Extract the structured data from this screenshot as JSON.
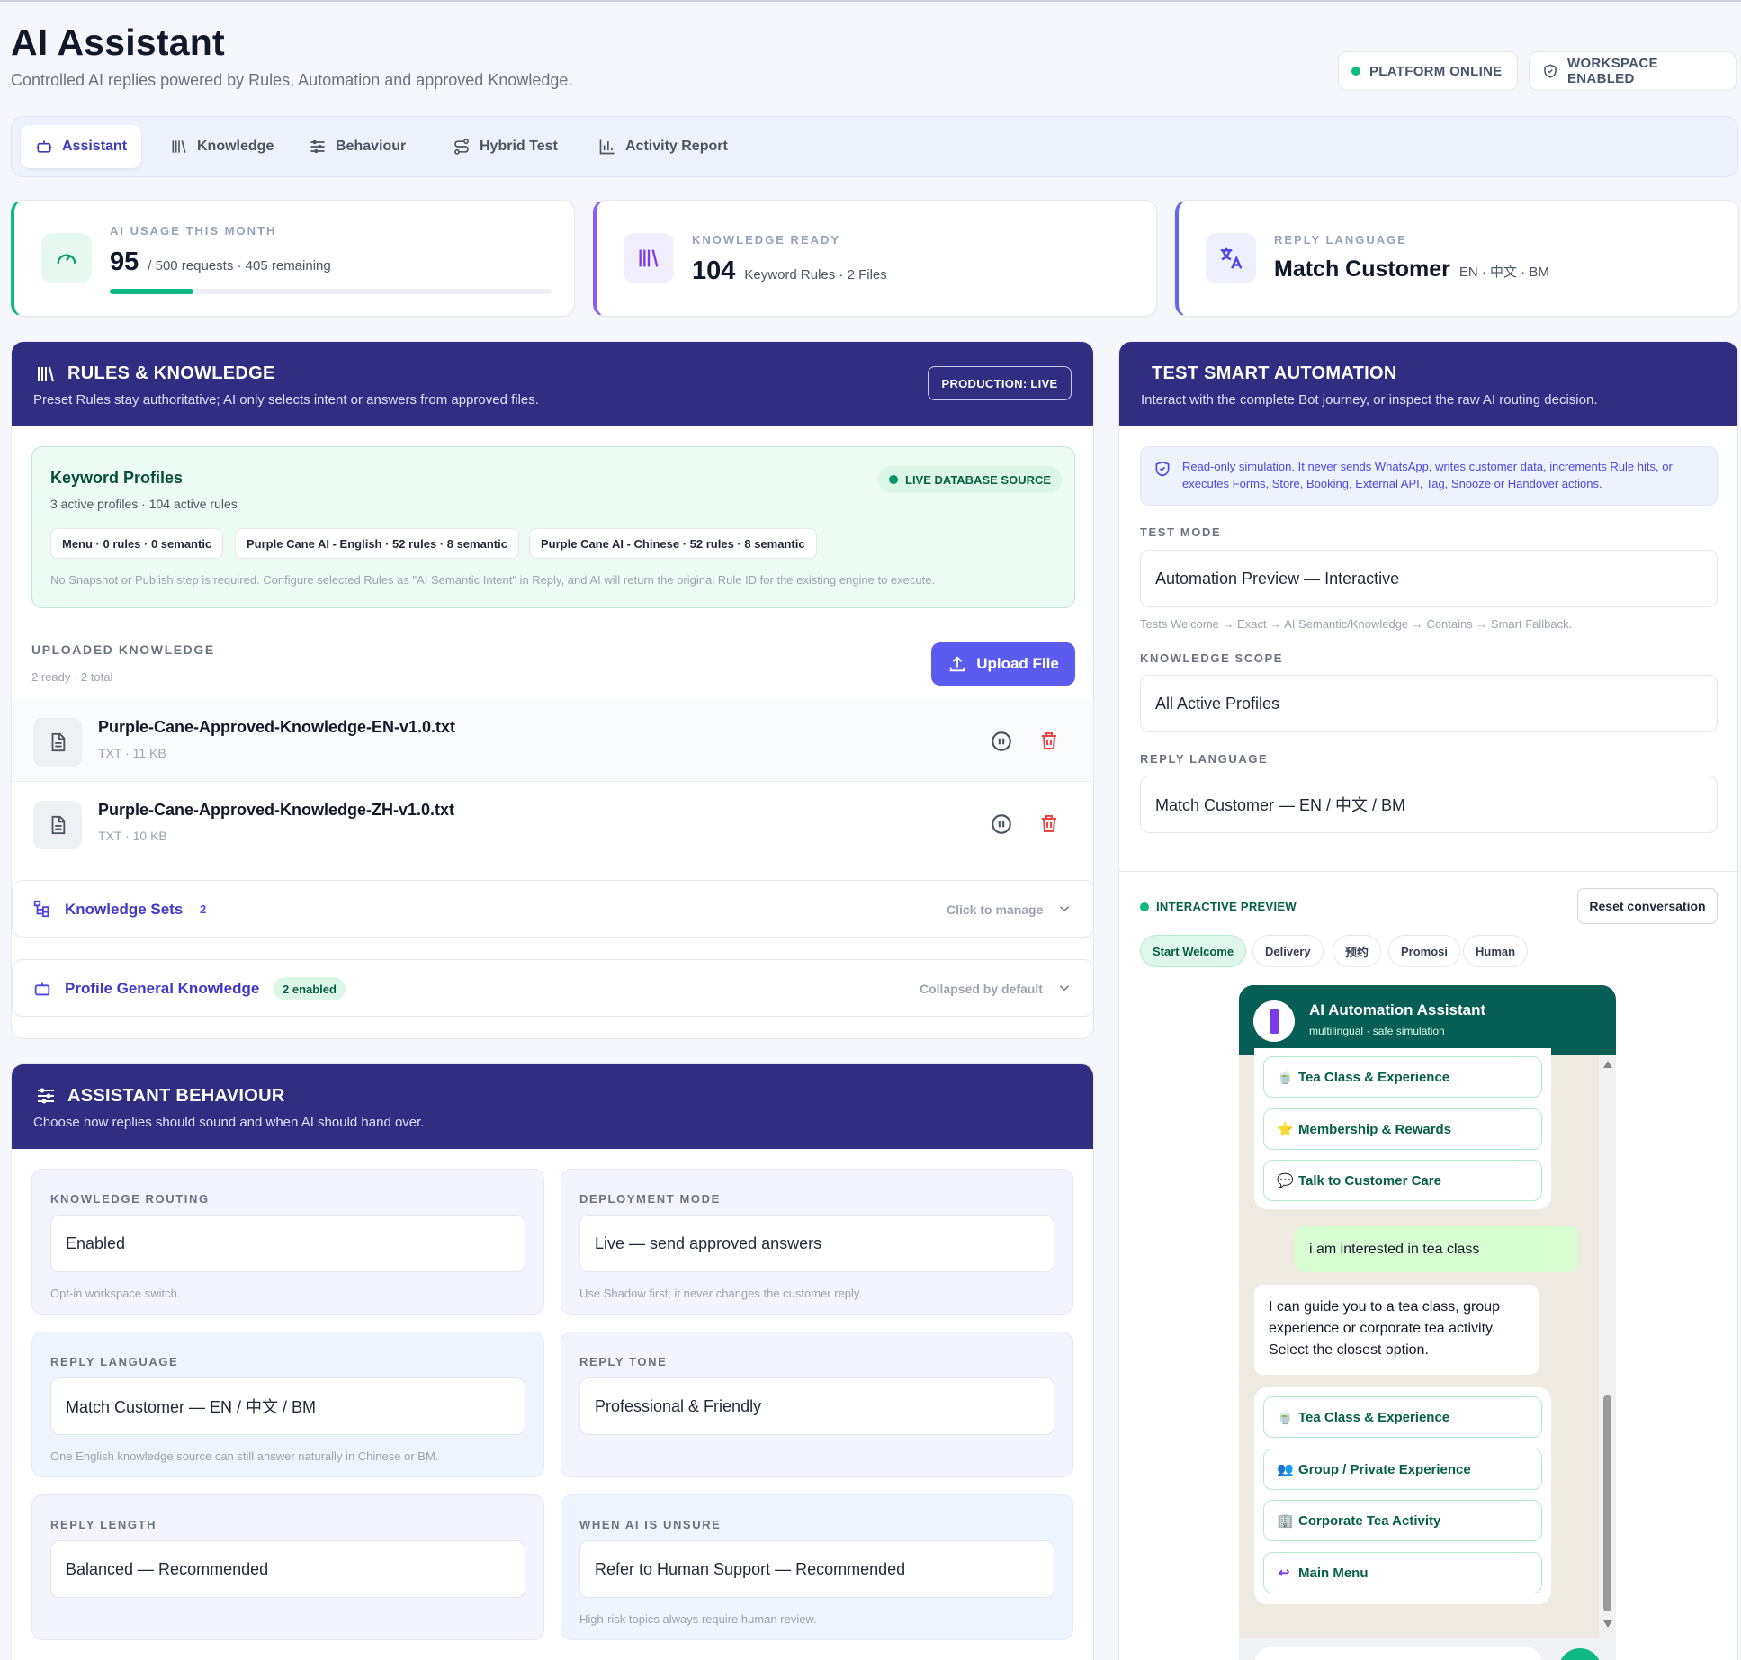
{
  "header": {
    "title": "AI Assistant",
    "subtitle": "Controlled AI replies powered by Rules, Automation and approved Knowledge.",
    "status_online": "PLATFORM ONLINE",
    "status_workspace": "WORKSPACE ENABLED"
  },
  "tabs": [
    {
      "label": "Assistant",
      "icon": "bot-icon"
    },
    {
      "label": "Knowledge",
      "icon": "library-icon"
    },
    {
      "label": "Behaviour",
      "icon": "sliders-icon"
    },
    {
      "label": "Hybrid Test",
      "icon": "route-icon"
    },
    {
      "label": "Activity Report",
      "icon": "bar-chart-icon"
    }
  ],
  "stats": {
    "usage": {
      "label": "AI USAGE THIS MONTH",
      "value": "95",
      "detail": "/ 500 requests · 405 remaining",
      "progress": 0.19,
      "accent": "#10b981"
    },
    "knowledge": {
      "label": "KNOWLEDGE READY",
      "value": "104",
      "detail": "Keyword Rules · 2 Files",
      "accent": "#8b5cf6"
    },
    "language": {
      "label": "REPLY LANGUAGE",
      "value": "Match Customer",
      "detail": "EN · 中文 · BM",
      "accent": "#6366f1"
    }
  },
  "rules": {
    "title": "RULES & KNOWLEDGE",
    "subtitle": "Preset Rules stay authoritative; AI only selects intent or answers from approved files.",
    "badge": "PRODUCTION: LIVE",
    "profiles": {
      "title": "Keyword Profiles",
      "summary": "3 active profiles · 104 active rules",
      "source": "LIVE DATABASE SOURCE",
      "chips": [
        "Menu · 0 rules · 0 semantic",
        "Purple Cane AI - English · 52 rules · 8 semantic",
        "Purple Cane AI - Chinese · 52 rules · 8 semantic"
      ],
      "note": "No Snapshot or Publish step is required. Configure selected Rules as \"AI Semantic Intent\" in Reply, and AI will return the original Rule ID for the existing engine to execute."
    },
    "uploaded": {
      "label": "UPLOADED KNOWLEDGE",
      "summary": "2 ready · 2 total",
      "upload_label": "Upload File",
      "files": [
        {
          "name": "Purple-Cane-Approved-Knowledge-EN-v1.0.txt",
          "meta": "TXT · 11 KB"
        },
        {
          "name": "Purple-Cane-Approved-Knowledge-ZH-v1.0.txt",
          "meta": "TXT · 10 KB"
        }
      ]
    },
    "sets": {
      "label": "Knowledge Sets",
      "count": "2",
      "hint": "Click to manage"
    },
    "general": {
      "label": "Profile General Knowledge",
      "badge": "2 enabled",
      "hint": "Collapsed by default"
    }
  },
  "behaviour": {
    "title": "ASSISTANT BEHAVIOUR",
    "subtitle": "Choose how replies should sound and when AI should hand over.",
    "cards": [
      {
        "label": "KNOWLEDGE ROUTING",
        "value": "Enabled",
        "hint": "Opt-in workspace switch."
      },
      {
        "label": "DEPLOYMENT MODE",
        "value": "Live — send approved answers",
        "hint": "Use Shadow first; it never changes the customer reply."
      },
      {
        "label": "REPLY LANGUAGE",
        "value": "Match Customer — EN / 中文 / BM",
        "hint": "One English knowledge source can still answer naturally in Chinese or BM."
      },
      {
        "label": "REPLY TONE",
        "value": "Professional & Friendly",
        "hint": ""
      },
      {
        "label": "REPLY LENGTH",
        "value": "Balanced — Recommended",
        "hint": ""
      },
      {
        "label": "WHEN AI IS UNSURE",
        "value": "Refer to Human Support — Recommended",
        "hint": "High-risk topics always require human review."
      }
    ]
  },
  "test": {
    "title": "TEST SMART AUTOMATION",
    "subtitle": "Interact with the complete Bot journey, or inspect the raw AI routing decision.",
    "notice": "Read-only simulation. It never sends WhatsApp, writes customer data, increments Rule hits, or executes Forms, Store, Booking, External API, Tag, Snooze or Handover actions.",
    "mode_label": "TEST MODE",
    "mode_value": "Automation Preview — Interactive",
    "mode_hint": "Tests Welcome → Exact → AI Semantic/Knowledge → Contains → Smart Fallback.",
    "scope_label": "KNOWLEDGE SCOPE",
    "scope_value": "All Active Profiles",
    "lang_label": "REPLY LANGUAGE",
    "lang_value": "Match Customer — EN / 中文 / BM",
    "preview_label": "INTERACTIVE PREVIEW",
    "reset_label": "Reset conversation",
    "quick": [
      "Start Welcome",
      "Delivery",
      "预约",
      "Promosi",
      "Human"
    ],
    "chat": {
      "name": "AI Automation Assistant",
      "tagline": "multilingual · safe simulation",
      "options_top": [
        {
          "label": "Tea Class & Experience",
          "emoji": "🍵"
        },
        {
          "label": "Membership & Rewards",
          "emoji": "⭐"
        },
        {
          "label": "Talk to Customer Care",
          "emoji": "💬"
        }
      ],
      "user_msg": "i am interested in tea class",
      "bot_msg": "I can guide you to a tea class, group experience or corporate tea activity. Select the closest option.",
      "options_bottom": [
        {
          "label": "Tea Class & Experience",
          "emoji": "🍵"
        },
        {
          "label": "Group / Private Experience",
          "emoji": "👥"
        },
        {
          "label": "Corporate Tea Activity",
          "emoji": "🏢"
        },
        {
          "label": "Main Menu",
          "emoji": "↩"
        }
      ]
    }
  }
}
